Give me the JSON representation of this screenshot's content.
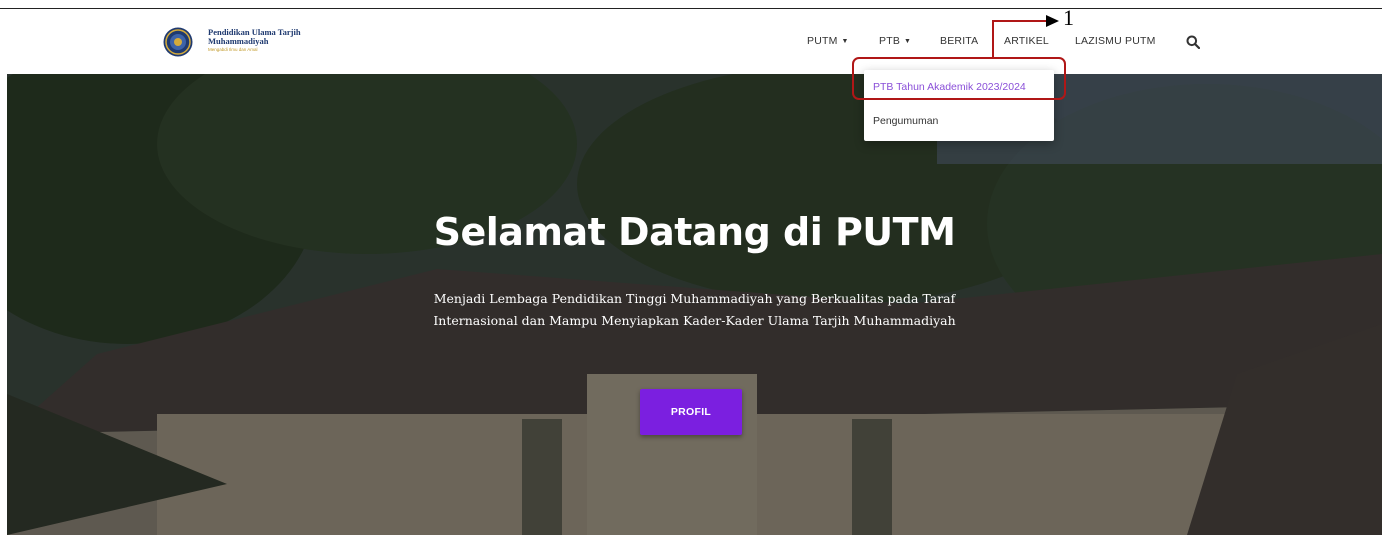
{
  "brand": {
    "name_line1": "Pendidikan Ulama Tarjih",
    "name_line2": "Muhammadiyah",
    "tagline": "Mengabdi Ilmu dan Amal"
  },
  "nav": {
    "items": [
      {
        "label": "PUTM",
        "has_caret": true
      },
      {
        "label": "PTB",
        "has_caret": true
      },
      {
        "label": "BERITA",
        "has_caret": false
      },
      {
        "label": "ARTIKEL",
        "has_caret": false
      },
      {
        "label": "LAZISMU PUTM",
        "has_caret": false
      }
    ],
    "search_icon": "search-icon"
  },
  "dropdown": {
    "items": [
      {
        "label": "PTB Tahun Akademik 2023/2024",
        "state": "highlighted"
      },
      {
        "label": "Pengumuman",
        "state": "normal"
      }
    ]
  },
  "hero": {
    "title": "Selamat Datang di PUTM",
    "subtitle_line1": "Menjadi Lembaga Pendidikan Tinggi Muhammadiyah yang Berkualitas pada Taraf",
    "subtitle_line2": "Internasional dan Mampu Menyiapkan Kader-Kader Ulama Tarjih Muhammadiyah",
    "button_label": "PROFIL"
  },
  "annotation": {
    "step_number": "1"
  },
  "colors": {
    "accent": "#7b1fe0",
    "dropdown_active_text": "#8a4fd8",
    "annotation_red": "#b01717",
    "brand_text": "#1f3a70"
  }
}
